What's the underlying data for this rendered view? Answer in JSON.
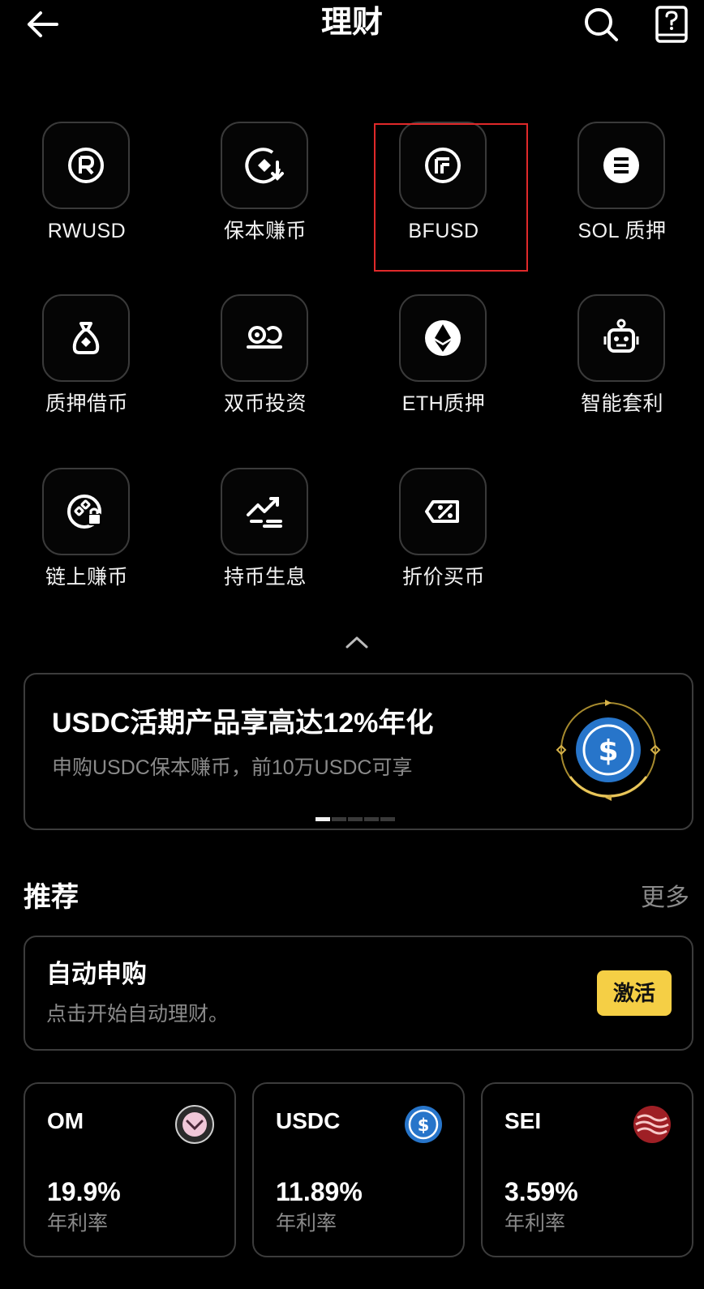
{
  "header": {
    "title": "理财"
  },
  "products": [
    {
      "label": "RWUSD",
      "icon": "rwusd-icon"
    },
    {
      "label": "保本赚币",
      "icon": "principal-protected-icon"
    },
    {
      "label": "BFUSD",
      "icon": "bfusd-icon"
    },
    {
      "label": "SOL 质押",
      "icon": "sol-staking-icon"
    },
    {
      "label": "质押借币",
      "icon": "collateral-loan-icon"
    },
    {
      "label": "双币投资",
      "icon": "dual-investment-icon"
    },
    {
      "label": "ETH质押",
      "icon": "eth-staking-icon"
    },
    {
      "label": "智能套利",
      "icon": "robot-icon"
    },
    {
      "label": "链上赚币",
      "icon": "onchain-earn-icon"
    },
    {
      "label": "持币生息",
      "icon": "hold-interest-icon"
    },
    {
      "label": "折价买币",
      "icon": "discount-buy-icon"
    }
  ],
  "banner": {
    "title": "USDC活期产品享高达12%年化",
    "subtitle": "申购USDC保本赚币，前10万USDC可享",
    "slides": 5,
    "active_slide": 1
  },
  "recommend": {
    "title": "推荐",
    "more": "更多",
    "auto": {
      "title": "自动申购",
      "subtitle": "点击开始自动理财。",
      "button": "激活"
    },
    "coins": [
      {
        "name": "OM",
        "rate": "19.9%",
        "rate_label": "年利率",
        "icon": "om-coin-icon"
      },
      {
        "name": "USDC",
        "rate": "11.89%",
        "rate_label": "年利率",
        "icon": "usdc-coin-icon"
      },
      {
        "name": "SEI",
        "rate": "3.59%",
        "rate_label": "年利率",
        "icon": "sei-coin-icon"
      }
    ]
  },
  "colors": {
    "accent": "#f5cf45",
    "highlight": "#e0292a",
    "usdc": "#2775ca",
    "sei": "#9e1f25"
  }
}
